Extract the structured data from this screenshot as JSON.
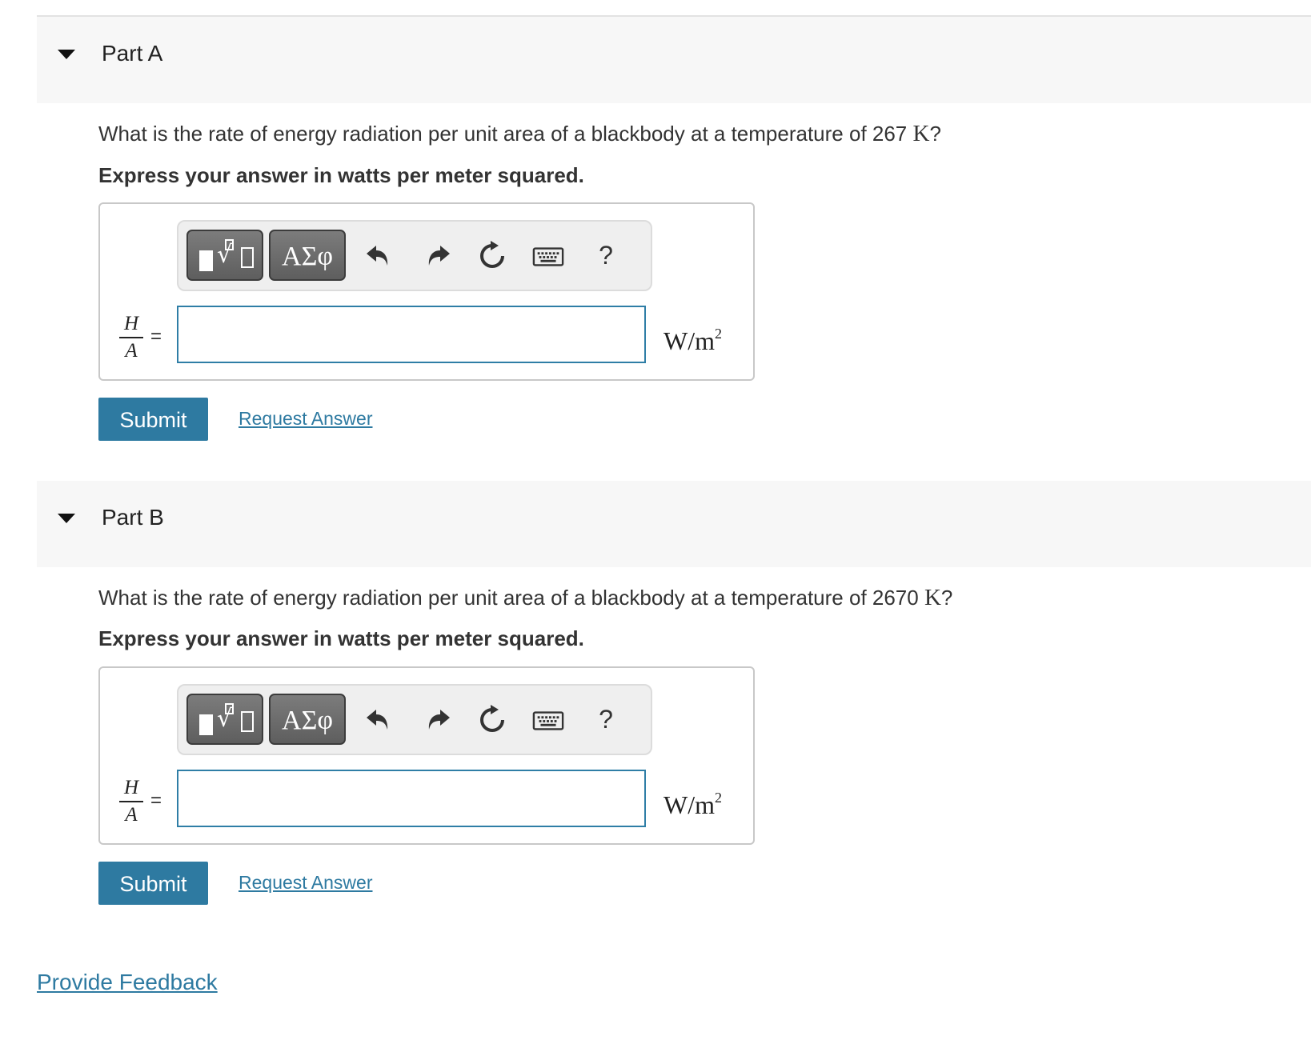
{
  "parts": [
    {
      "title": "Part A",
      "question_pre": "What is the rate of energy radiation per unit area of a blackbody at a temperature of 267",
      "question_unit": "K",
      "question_post": "?",
      "instruction": "Express your answer in watts per meter squared.",
      "toolbar": {
        "symbols_label": "ΑΣφ",
        "help_label": "?"
      },
      "lhs_numerator": "H",
      "lhs_denominator": "A",
      "equals": "=",
      "answer_value": "",
      "units_base": "W/m",
      "units_exp": "2",
      "submit_label": "Submit",
      "request_label": "Request Answer"
    },
    {
      "title": "Part B",
      "question_pre": "What is the rate of energy radiation per unit area of a blackbody at a temperature of 2670",
      "question_unit": "K",
      "question_post": "?",
      "instruction": "Express your answer in watts per meter squared.",
      "toolbar": {
        "symbols_label": "ΑΣφ",
        "help_label": "?"
      },
      "lhs_numerator": "H",
      "lhs_denominator": "A",
      "equals": "=",
      "answer_value": "",
      "units_base": "W/m",
      "units_exp": "2",
      "submit_label": "Submit",
      "request_label": "Request Answer"
    }
  ],
  "feedback_label": "Provide Feedback",
  "colors": {
    "accent": "#2e7aa1",
    "header_bg": "#f7f7f7",
    "input_border": "#2f7ea6"
  }
}
